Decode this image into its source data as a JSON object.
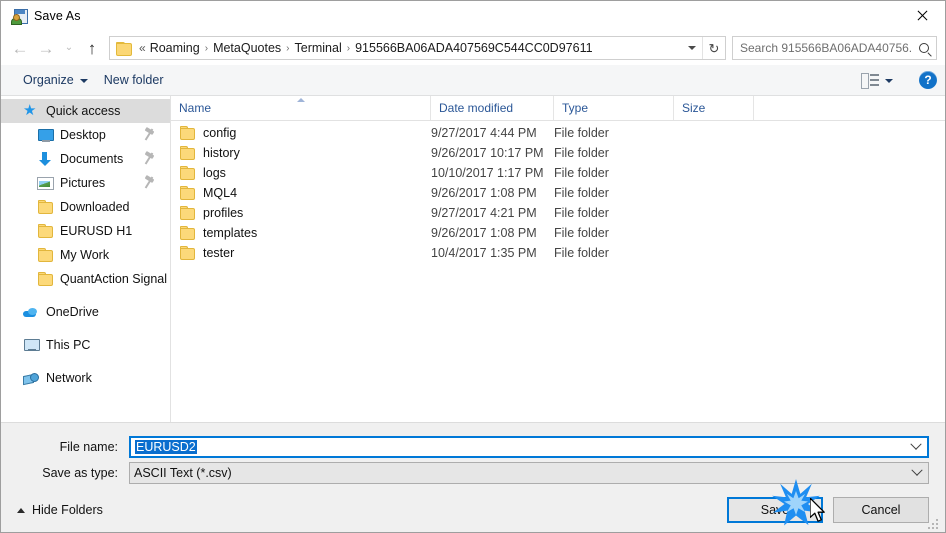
{
  "window": {
    "title": "Save As",
    "title_icon": "save-as-icon",
    "close_label": "×"
  },
  "nav": {
    "back_icon": "arrow-left-icon",
    "forward_icon": "arrow-right-icon",
    "recent_icon": "chevron-down-icon",
    "up_icon": "arrow-up-icon",
    "back_glyph": "←",
    "forward_glyph": "→",
    "recent_glyph": "⌄",
    "up_glyph": "↑",
    "refresh_glyph": "↻"
  },
  "address": {
    "folder_icon": "folder-icon",
    "overflow": "«",
    "separator": "›",
    "crumbs": [
      "Roaming",
      "MetaQuotes",
      "Terminal",
      "915566BA06ADA407569C544CC0D97611"
    ]
  },
  "search": {
    "placeholder": "Search 915566BA06ADA40756...",
    "icon": "search-icon"
  },
  "toolbar": {
    "organize_label": "Organize",
    "new_folder_label": "New folder",
    "view_icon": "view-layout-icon",
    "help_label": "?"
  },
  "sidebar": {
    "items": [
      {
        "label": "Quick access",
        "icon": "star-icon",
        "selected": true,
        "indent": false,
        "pinned": false,
        "gap_before": false
      },
      {
        "label": "Desktop",
        "icon": "desktop-icon",
        "selected": false,
        "indent": true,
        "pinned": true,
        "gap_before": false
      },
      {
        "label": "Documents",
        "icon": "documents-icon",
        "selected": false,
        "indent": true,
        "pinned": true,
        "gap_before": false
      },
      {
        "label": "Pictures",
        "icon": "pictures-icon",
        "selected": false,
        "indent": true,
        "pinned": true,
        "gap_before": false
      },
      {
        "label": "Downloaded",
        "icon": "folder-icon",
        "selected": false,
        "indent": true,
        "pinned": false,
        "gap_before": false
      },
      {
        "label": "EURUSD H1",
        "icon": "folder-icon",
        "selected": false,
        "indent": true,
        "pinned": false,
        "gap_before": false
      },
      {
        "label": "My Work",
        "icon": "folder-icon",
        "selected": false,
        "indent": true,
        "pinned": false,
        "gap_before": false
      },
      {
        "label": "QuantAction Signal",
        "icon": "folder-icon",
        "selected": false,
        "indent": true,
        "pinned": false,
        "gap_before": false
      },
      {
        "label": "OneDrive",
        "icon": "onedrive-icon",
        "selected": false,
        "indent": false,
        "pinned": false,
        "gap_before": true
      },
      {
        "label": "This PC",
        "icon": "this-pc-icon",
        "selected": false,
        "indent": false,
        "pinned": false,
        "gap_before": true
      },
      {
        "label": "Network",
        "icon": "network-icon",
        "selected": false,
        "indent": false,
        "pinned": false,
        "gap_before": true
      }
    ]
  },
  "filelist": {
    "columns": [
      "Name",
      "Date modified",
      "Type",
      "Size"
    ],
    "sort_column": "Name",
    "sort_direction": "ascending",
    "rows": [
      {
        "name": "config",
        "date": "9/27/2017 4:44 PM",
        "type": "File folder",
        "size": ""
      },
      {
        "name": "history",
        "date": "9/26/2017 10:17 PM",
        "type": "File folder",
        "size": ""
      },
      {
        "name": "logs",
        "date": "10/10/2017 1:17 PM",
        "type": "File folder",
        "size": ""
      },
      {
        "name": "MQL4",
        "date": "9/26/2017 1:08 PM",
        "type": "File folder",
        "size": ""
      },
      {
        "name": "profiles",
        "date": "9/27/2017 4:21 PM",
        "type": "File folder",
        "size": ""
      },
      {
        "name": "templates",
        "date": "9/26/2017 1:08 PM",
        "type": "File folder",
        "size": ""
      },
      {
        "name": "tester",
        "date": "10/4/2017 1:35 PM",
        "type": "File folder",
        "size": ""
      }
    ]
  },
  "form": {
    "filename_label": "File name:",
    "filename_value": "EURUSD2",
    "filetype_label": "Save as type:",
    "filetype_value": "ASCII Text (*.csv)"
  },
  "footer": {
    "hide_folders_label": "Hide Folders",
    "save_label": "Save",
    "cancel_label": "Cancel"
  },
  "overlay": {
    "click_effect": "click-burst",
    "cursor": "mouse-pointer"
  },
  "colors": {
    "accent": "#0078d7",
    "crumb_text": "#1b1b1b",
    "toolbar_text": "#1d3a63",
    "selection": "#0a6ece",
    "folder": "#fcd97a",
    "help_blue": "#1272c8",
    "burst": "#1f8ef1"
  }
}
